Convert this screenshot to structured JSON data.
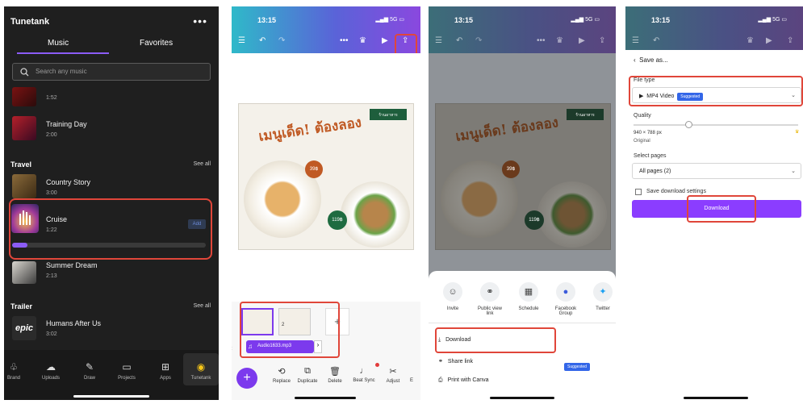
{
  "panel1": {
    "app_title": "Tunetank",
    "menu_label": "•••",
    "tabs": [
      "Music",
      "Favorites"
    ],
    "search_placeholder": "Search any music",
    "tracks_top": [
      {
        "name": "",
        "time": "1:52"
      },
      {
        "name": "Training Day",
        "time": "2:00"
      }
    ],
    "travel": {
      "title": "Travel",
      "see_all": "See all",
      "tracks": [
        {
          "name": "Country Story",
          "time": "3:00"
        },
        {
          "name": "Cruise",
          "time": "1:22",
          "action": "Add"
        },
        {
          "name": "Summer Dream",
          "time": "2:13"
        }
      ]
    },
    "trailer": {
      "title": "Trailer",
      "see_all": "See all",
      "tracks": [
        {
          "name": "Humans After Us",
          "time": "3:02"
        }
      ]
    },
    "nav": [
      "Brand",
      "Uploads",
      "Draw",
      "Projects",
      "Apps",
      "Tunetank"
    ],
    "cruise_progress": 0.08,
    "accent": "#8b5cf6"
  },
  "panel2": {
    "time": "13:15",
    "signal": "5G",
    "page_number": "2",
    "audio_label": "Audio1633.mp3",
    "tools": [
      "Replace",
      "Duplicate",
      "Delete",
      "Beat Sync",
      "Adjust",
      "E"
    ]
  },
  "panel3": {
    "time": "13:15",
    "signal": "5G",
    "share_targets": [
      "Invite",
      "Public view link",
      "Schedule",
      "Facebook Group",
      "Twitter"
    ],
    "rows": [
      "Download",
      "Share link",
      "Print with Canva"
    ],
    "share_badge": "Suggested"
  },
  "panel4": {
    "time": "13:15",
    "signal": "5G",
    "back_label": "Save as...",
    "file_type_label": "File type",
    "file_type_value": "MP4 Video",
    "file_type_badge": "Suggested",
    "quality_label": "Quality",
    "quality_dims": "940 × 788 px",
    "quality_sub": "Original",
    "select_pages_label": "Select pages",
    "pages_value": "All pages (2)",
    "save_settings": "Save download settings",
    "download_btn": "Download",
    "brand_purple": "#8b3dff"
  },
  "poster": {
    "title_text": "เมนูเด็ด! ต้องลอง",
    "tag_text": "ร้านอาหาร",
    "price1": "39฿",
    "price2": "119฿"
  }
}
